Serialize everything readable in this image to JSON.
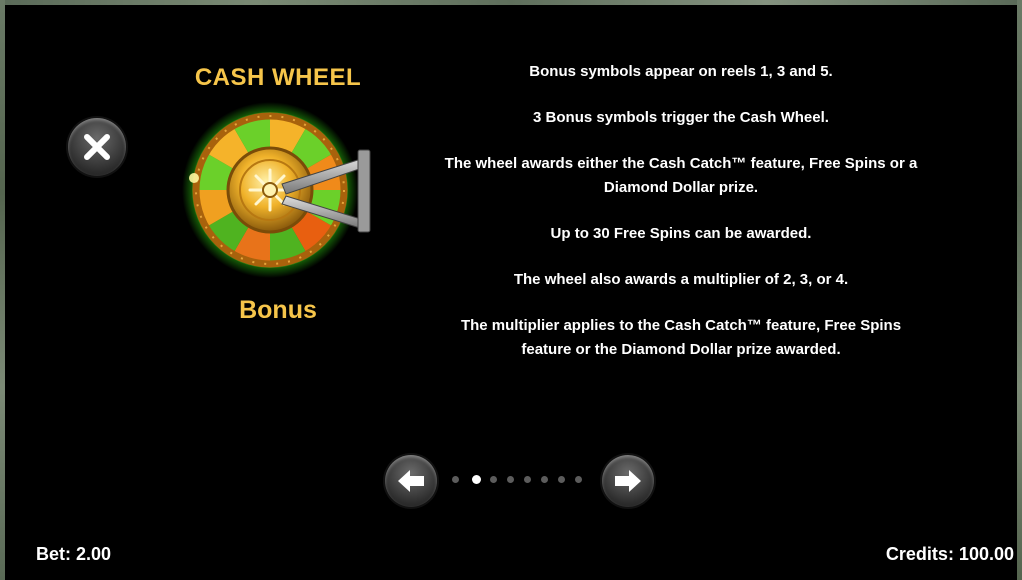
{
  "symbol": {
    "title": "CASH WHEEL",
    "name": "Bonus",
    "icon": "cash-wheel-vault-icon"
  },
  "description": [
    "Bonus symbols appear on reels 1, 3 and 5.",
    "3 Bonus symbols trigger the Cash Wheel.",
    "The wheel awards either the Cash Catch™ feature, Free Spins or a Diamond Dollar prize.",
    "Up to 30 Free Spins can be awarded.",
    "The wheel also awards a multiplier of 2, 3, or 4.",
    "The multiplier applies to the Cash Catch™ feature, Free Spins feature or the Diamond Dollar prize awarded."
  ],
  "pagination": {
    "total_pages": 8,
    "current_page": 2,
    "prev_icon": "arrow-left-icon",
    "next_icon": "arrow-right-icon"
  },
  "close_icon": "close-icon",
  "footer": {
    "bet": "Bet: 2.00",
    "credits": "Credits: 100.00"
  },
  "colors": {
    "accent_gold": "#f6c54a",
    "text": "#ffffff",
    "background": "#000000",
    "active_dot": "#ffffff",
    "inactive_dot": "#5c5c5c"
  }
}
